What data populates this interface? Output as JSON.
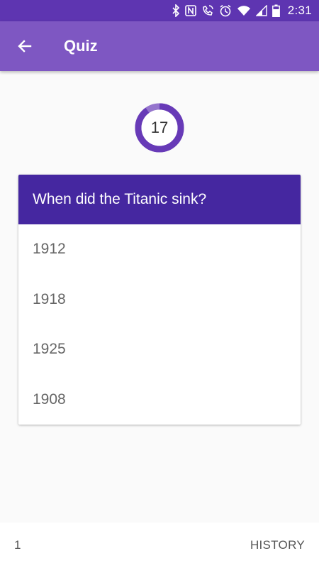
{
  "status_bar": {
    "time": "2:31",
    "icons": [
      "bluetooth-icon",
      "nfc-icon",
      "wifi-calling-icon",
      "alarm-icon",
      "wifi-icon",
      "signal-icon",
      "battery-icon"
    ],
    "color": "#5e35b1"
  },
  "app_bar": {
    "title": "Quiz",
    "back_icon": "arrow-back-icon",
    "color": "#7e57c2"
  },
  "timer": {
    "value": "17",
    "ring_color": "#673ab7",
    "track_color": "#9575cd"
  },
  "question": {
    "text": "When did the Titanic sink?",
    "header_color": "#4527a0",
    "answers": [
      {
        "label": "1912"
      },
      {
        "label": "1918"
      },
      {
        "label": "1925"
      },
      {
        "label": "1908"
      }
    ]
  },
  "bottom_bar": {
    "score": "1",
    "history_label": "HISTORY"
  }
}
